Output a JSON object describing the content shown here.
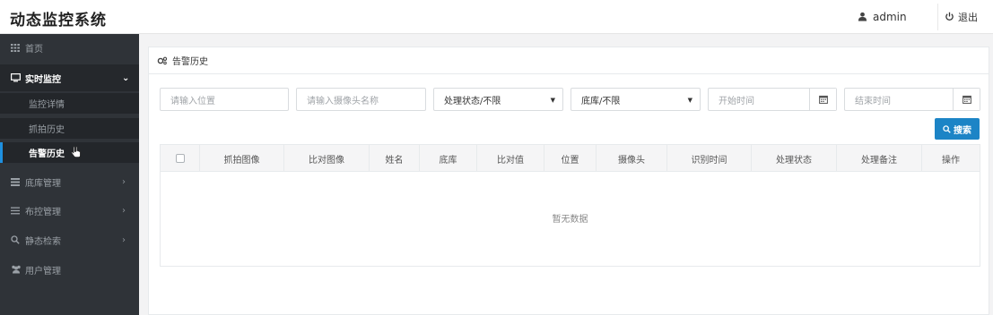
{
  "app": {
    "title": "动态监控系统"
  },
  "topbar": {
    "user_name": "admin",
    "logout_label": "退出"
  },
  "sidebar": {
    "items": [
      {
        "label": "首页",
        "icon": "grid-icon",
        "has_children": false
      },
      {
        "label": "实时监控",
        "icon": "monitor-icon",
        "has_children": true,
        "expanded": true
      },
      {
        "label": "底库管理",
        "icon": "database-icon",
        "has_children": true
      },
      {
        "label": "布控管理",
        "icon": "list-icon",
        "has_children": true
      },
      {
        "label": "静态检索",
        "icon": "search-icon",
        "has_children": true
      },
      {
        "label": "用户管理",
        "icon": "users-icon",
        "has_children": false
      }
    ],
    "sub_items": [
      {
        "label": "监控详情"
      },
      {
        "label": "抓拍历史"
      },
      {
        "label": "告警历史",
        "current": true
      }
    ],
    "chevron_right": "›",
    "chevron_down": "⌄"
  },
  "panel": {
    "title": "告警历史"
  },
  "filters": {
    "location_placeholder": "请输入位置",
    "camera_placeholder": "请输入摄像头名称",
    "status_selected": "处理状态/不限",
    "library_selected": "底库/不限",
    "start_time_placeholder": "开始时间",
    "end_time_placeholder": "结束时间"
  },
  "search_button": {
    "label": "搜索"
  },
  "table": {
    "columns": [
      "抓拍图像",
      "比对图像",
      "姓名",
      "底库",
      "比对值",
      "位置",
      "摄像头",
      "识别时间",
      "处理状态",
      "处理备注",
      "操作"
    ],
    "rows": [],
    "empty_text": "暂无数据"
  },
  "colors": {
    "sidebar_bg": "#2f3338",
    "accent": "#1c84c6",
    "active_bar": "#1e90e0"
  }
}
